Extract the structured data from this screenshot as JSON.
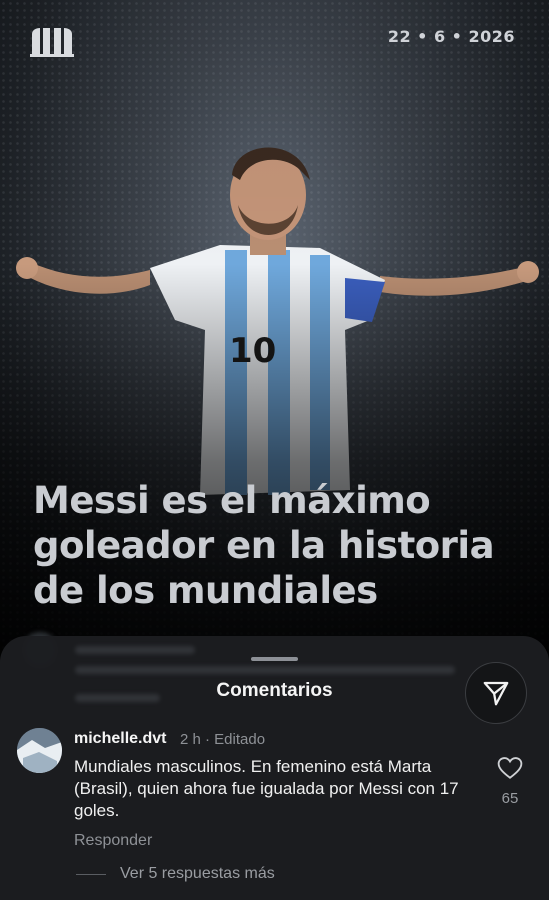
{
  "header": {
    "date": "22 • 6 • 2026"
  },
  "article": {
    "headline": "Messi es el máximo goleador en la historia de los mundiales"
  },
  "sheet": {
    "title": "Comentarios"
  },
  "comment": {
    "username": "michelle.dvt",
    "meta": "2 h · Editado",
    "text": "Mundiales masculinos. En femenino está Marta (Brasil), quien ahora fue igualada por Messi con 17 goles.",
    "likes": "65",
    "reply_label": "Responder"
  },
  "more_replies": "Ver 5 respuestas más",
  "icons": {
    "logo": "book-logo-icon",
    "share": "send-icon",
    "like": "heart-icon"
  },
  "colors": {
    "sheet_bg": "#1c1d20",
    "headline": "#c9ccd1",
    "jersey_blue": "#6fa8dc"
  }
}
